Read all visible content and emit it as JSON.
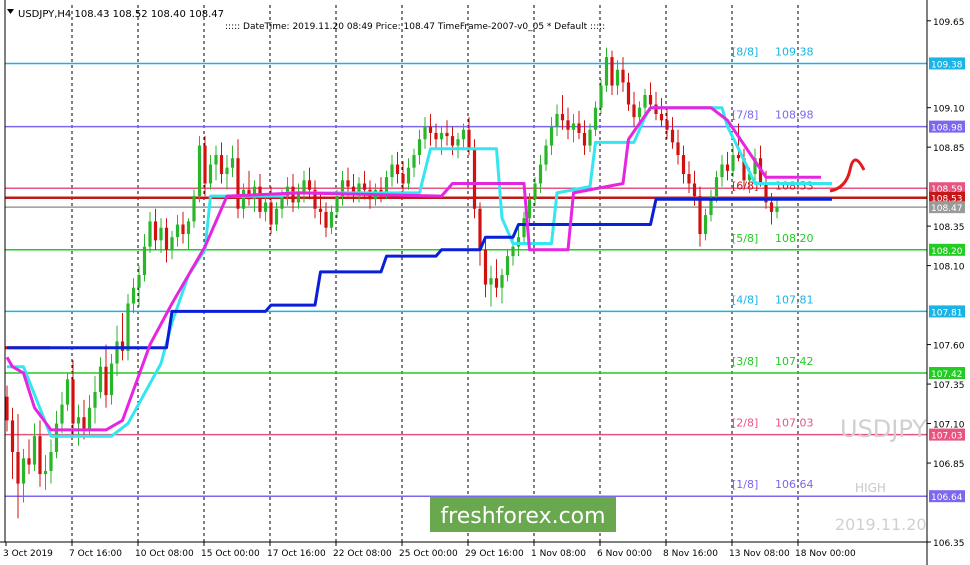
{
  "header": {
    "symbol_line": "USDJPY,H4  108.43 108.52 108.40 108.47",
    "info_line": "::::: DateTime: 2019.11.20 08:49   Price: 108.47   TimeFrame-2007-v0_05   *   Default   :::::"
  },
  "watermark": {
    "symbol": "USDJPY",
    "high_label": "HIGH",
    "datetime": "2019.11.20"
  },
  "brand": {
    "text": "freshforex.com",
    "color": "#6aa84f"
  },
  "colors": {
    "bull": "#2ab52a",
    "bear": "#d11010",
    "cyan_line": "#33e6f0",
    "blue_line": "#0a1fd8",
    "magenta_line": "#e526e0",
    "grid": "#000000"
  },
  "chart_data": {
    "type": "candlestick",
    "ylim": [
      106.35,
      109.75
    ],
    "y_ticks": [
      {
        "value": 109.65,
        "label": "109.65"
      },
      {
        "value": 109.38,
        "label": "109.38"
      },
      {
        "value": 109.1,
        "label": "109.10"
      },
      {
        "value": 108.98,
        "label": "108.98"
      },
      {
        "value": 108.85,
        "label": "108.85"
      },
      {
        "value": 108.59,
        "label": "108.59"
      },
      {
        "value": 108.53,
        "label": "108.53"
      },
      {
        "value": 108.47,
        "label": "108.47"
      },
      {
        "value": 108.35,
        "label": "108.35"
      },
      {
        "value": 108.2,
        "label": "108.20"
      },
      {
        "value": 108.1,
        "label": "108.10"
      },
      {
        "value": 107.81,
        "label": "107.81"
      },
      {
        "value": 107.6,
        "label": "107.60"
      },
      {
        "value": 107.42,
        "label": "107.42"
      },
      {
        "value": 107.35,
        "label": "107.35"
      },
      {
        "value": 107.1,
        "label": "107.10"
      },
      {
        "value": 107.03,
        "label": "107.03"
      },
      {
        "value": 106.85,
        "label": "106.85"
      },
      {
        "value": 106.64,
        "label": "106.64"
      },
      {
        "value": 106.35,
        "label": "106.35"
      }
    ],
    "x_labels": [
      {
        "label": "3 Oct 2019",
        "bar": 0
      },
      {
        "label": "7 Oct 16:00",
        "bar": 12
      },
      {
        "label": "10 Oct 08:00",
        "bar": 24
      },
      {
        "label": "15 Oct 00:00",
        "bar": 36
      },
      {
        "label": "17 Oct 16:00",
        "bar": 48
      },
      {
        "label": "22 Oct 08:00",
        "bar": 60
      },
      {
        "label": "25 Oct 00:00",
        "bar": 72
      },
      {
        "label": "29 Oct 16:00",
        "bar": 84
      },
      {
        "label": "1 Nov 08:00",
        "bar": 96
      },
      {
        "label": "6 Nov 00:00",
        "bar": 108
      },
      {
        "label": "8 Nov 16:00",
        "bar": 120
      },
      {
        "label": "13 Nov 08:00",
        "bar": 132
      },
      {
        "label": "18 Nov 00:00",
        "bar": 144
      }
    ],
    "levels": [
      {
        "name": "[8/8]",
        "value": 109.38,
        "label": "109.38",
        "color": "#19b3e6"
      },
      {
        "name": "[7/8]",
        "value": 108.98,
        "label": "108.98",
        "color": "#7b68ee"
      },
      {
        "name": "",
        "value": 108.59,
        "label": "108.59",
        "color": "#e75480"
      },
      {
        "name": "[6/8]",
        "value": 108.53,
        "label": "108.53",
        "color": "#c41818"
      },
      {
        "name": "",
        "value": 108.47,
        "label": "108.47",
        "color": "#9a9a9a"
      },
      {
        "name": "[5/8]",
        "value": 108.2,
        "label": "108.20",
        "color": "#22cc22"
      },
      {
        "name": "[4/8]",
        "value": 107.81,
        "label": "107.81",
        "color": "#19b3e6"
      },
      {
        "name": "[3/8]",
        "value": 107.42,
        "label": "107.42",
        "color": "#22cc22"
      },
      {
        "name": "[2/8]",
        "value": 107.03,
        "label": "107.03",
        "color": "#e75480"
      },
      {
        "name": "[1/8]",
        "value": 106.64,
        "label": "106.64",
        "color": "#7b68ee"
      }
    ],
    "candles": [
      [
        107.27,
        107.34,
        107.05,
        107.12
      ],
      [
        107.12,
        107.2,
        106.75,
        106.92
      ],
      [
        106.92,
        107.16,
        106.5,
        106.72
      ],
      [
        106.72,
        106.94,
        106.6,
        106.88
      ],
      [
        106.88,
        107.0,
        106.78,
        106.84
      ],
      [
        106.84,
        107.1,
        106.8,
        107.02
      ],
      [
        107.02,
        107.12,
        106.7,
        106.78
      ],
      [
        106.78,
        106.9,
        106.68,
        106.8
      ],
      [
        106.8,
        107.0,
        106.72,
        106.92
      ],
      [
        106.92,
        107.18,
        106.88,
        107.1
      ],
      [
        107.1,
        107.3,
        107.04,
        107.22
      ],
      [
        107.22,
        107.42,
        107.18,
        107.38
      ],
      [
        107.38,
        107.5,
        107.02,
        107.1
      ],
      [
        107.1,
        107.22,
        106.96,
        107.14
      ],
      [
        107.14,
        107.25,
        107.0,
        107.06
      ],
      [
        107.06,
        107.28,
        107.02,
        107.2
      ],
      [
        107.2,
        107.4,
        107.1,
        107.3
      ],
      [
        107.3,
        107.52,
        107.26,
        107.46
      ],
      [
        107.46,
        107.6,
        107.2,
        107.28
      ],
      [
        107.28,
        107.54,
        107.22,
        107.48
      ],
      [
        107.48,
        107.72,
        107.4,
        107.62
      ],
      [
        107.62,
        107.8,
        107.5,
        107.56
      ],
      [
        107.56,
        107.92,
        107.5,
        107.86
      ],
      [
        107.86,
        108.02,
        107.8,
        107.96
      ],
      [
        107.96,
        108.1,
        107.84,
        108.04
      ],
      [
        108.04,
        108.3,
        108.0,
        108.22
      ],
      [
        108.22,
        108.44,
        108.18,
        108.38
      ],
      [
        108.38,
        108.46,
        108.2,
        108.26
      ],
      [
        108.26,
        108.4,
        108.18,
        108.34
      ],
      [
        108.34,
        108.4,
        108.12,
        108.2
      ],
      [
        108.2,
        108.32,
        108.14,
        108.28
      ],
      [
        108.28,
        108.42,
        108.22,
        108.36
      ],
      [
        108.36,
        108.44,
        108.24,
        108.3
      ],
      [
        108.3,
        108.4,
        108.2,
        108.38
      ],
      [
        108.38,
        108.58,
        108.34,
        108.54
      ],
      [
        108.54,
        108.92,
        108.5,
        108.86
      ],
      [
        108.86,
        108.92,
        108.54,
        108.62
      ],
      [
        108.62,
        108.8,
        108.58,
        108.74
      ],
      [
        108.74,
        108.86,
        108.64,
        108.8
      ],
      [
        108.8,
        108.88,
        108.62,
        108.68
      ],
      [
        108.68,
        108.8,
        108.58,
        108.72
      ],
      [
        108.72,
        108.86,
        108.66,
        108.78
      ],
      [
        108.78,
        108.9,
        108.4,
        108.46
      ],
      [
        108.46,
        108.62,
        108.4,
        108.58
      ],
      [
        108.58,
        108.7,
        108.48,
        108.52
      ],
      [
        108.52,
        108.64,
        108.44,
        108.6
      ],
      [
        108.6,
        108.68,
        108.4,
        108.44
      ],
      [
        108.44,
        108.56,
        108.38,
        108.5
      ],
      [
        108.5,
        108.6,
        108.3,
        108.36
      ],
      [
        108.36,
        108.5,
        108.32,
        108.46
      ],
      [
        108.46,
        108.58,
        108.4,
        108.54
      ],
      [
        108.54,
        108.66,
        108.48,
        108.6
      ],
      [
        108.6,
        108.68,
        108.44,
        108.5
      ],
      [
        108.5,
        108.62,
        108.46,
        108.56
      ],
      [
        108.56,
        108.7,
        108.5,
        108.64
      ],
      [
        108.64,
        108.72,
        108.52,
        108.58
      ],
      [
        108.58,
        108.64,
        108.4,
        108.46
      ],
      [
        108.46,
        108.56,
        108.36,
        108.44
      ],
      [
        108.44,
        108.5,
        108.28,
        108.34
      ],
      [
        108.34,
        108.48,
        108.3,
        108.44
      ],
      [
        108.44,
        108.58,
        108.4,
        108.54
      ],
      [
        108.54,
        108.7,
        108.48,
        108.64
      ],
      [
        108.64,
        108.72,
        108.54,
        108.6
      ],
      [
        108.6,
        108.68,
        108.5,
        108.56
      ],
      [
        108.56,
        108.66,
        108.5,
        108.62
      ],
      [
        108.62,
        108.7,
        108.52,
        108.58
      ],
      [
        108.58,
        108.64,
        108.46,
        108.52
      ],
      [
        108.52,
        108.62,
        108.48,
        108.58
      ],
      [
        108.58,
        108.66,
        108.5,
        108.54
      ],
      [
        108.54,
        108.7,
        108.52,
        108.66
      ],
      [
        108.66,
        108.8,
        108.6,
        108.74
      ],
      [
        108.74,
        108.82,
        108.62,
        108.68
      ],
      [
        108.68,
        108.76,
        108.54,
        108.62
      ],
      [
        108.62,
        108.78,
        108.58,
        108.72
      ],
      [
        108.72,
        108.84,
        108.66,
        108.8
      ],
      [
        108.8,
        108.96,
        108.74,
        108.9
      ],
      [
        108.9,
        109.04,
        108.84,
        108.98
      ],
      [
        108.98,
        109.06,
        108.86,
        108.94
      ],
      [
        108.94,
        109.0,
        108.84,
        108.9
      ],
      [
        108.9,
        108.98,
        108.8,
        108.94
      ],
      [
        108.94,
        109.02,
        108.86,
        108.92
      ],
      [
        108.92,
        108.98,
        108.8,
        108.86
      ],
      [
        108.86,
        108.94,
        108.78,
        108.9
      ],
      [
        108.9,
        109.0,
        108.84,
        108.96
      ],
      [
        108.96,
        109.04,
        108.8,
        108.84
      ],
      [
        108.84,
        108.9,
        108.4,
        108.46
      ],
      [
        108.46,
        108.5,
        108.1,
        108.2
      ],
      [
        108.2,
        108.28,
        107.9,
        107.98
      ],
      [
        107.98,
        108.1,
        107.84,
        108.02
      ],
      [
        108.02,
        108.14,
        107.9,
        107.96
      ],
      [
        107.96,
        108.08,
        107.86,
        108.04
      ],
      [
        108.04,
        108.2,
        108.0,
        108.16
      ],
      [
        108.16,
        108.3,
        108.1,
        108.22
      ],
      [
        108.22,
        108.34,
        108.16,
        108.28
      ],
      [
        108.28,
        108.44,
        108.24,
        108.4
      ],
      [
        108.4,
        108.56,
        108.36,
        108.52
      ],
      [
        108.52,
        108.66,
        108.48,
        108.62
      ],
      [
        108.62,
        108.8,
        108.56,
        108.74
      ],
      [
        108.74,
        108.9,
        108.7,
        108.86
      ],
      [
        108.86,
        109.04,
        108.8,
        108.98
      ],
      [
        108.98,
        109.12,
        108.92,
        109.06
      ],
      [
        109.06,
        109.18,
        108.96,
        109.02
      ],
      [
        109.02,
        109.1,
        108.9,
        108.96
      ],
      [
        108.96,
        109.06,
        108.88,
        109.0
      ],
      [
        109.0,
        109.08,
        108.9,
        108.94
      ],
      [
        108.94,
        109.02,
        108.8,
        108.86
      ],
      [
        108.86,
        109.0,
        108.82,
        108.96
      ],
      [
        108.96,
        109.14,
        108.92,
        109.1
      ],
      [
        109.1,
        109.28,
        109.06,
        109.24
      ],
      [
        109.24,
        109.48,
        109.2,
        109.42
      ],
      [
        109.42,
        109.46,
        109.18,
        109.24
      ],
      [
        109.24,
        109.4,
        109.18,
        109.34
      ],
      [
        109.34,
        109.42,
        109.2,
        109.26
      ],
      [
        109.26,
        109.32,
        109.08,
        109.12
      ],
      [
        109.12,
        109.2,
        108.98,
        109.04
      ],
      [
        109.04,
        109.14,
        108.94,
        109.1
      ],
      [
        109.1,
        109.22,
        109.04,
        109.18
      ],
      [
        109.18,
        109.26,
        109.08,
        109.12
      ],
      [
        109.12,
        109.2,
        109.02,
        109.06
      ],
      [
        109.06,
        109.16,
        108.98,
        109.02
      ],
      [
        109.02,
        109.1,
        108.9,
        108.96
      ],
      [
        108.96,
        109.04,
        108.84,
        108.88
      ],
      [
        108.88,
        108.96,
        108.74,
        108.8
      ],
      [
        108.8,
        108.86,
        108.62,
        108.68
      ],
      [
        108.68,
        108.76,
        108.56,
        108.62
      ],
      [
        108.62,
        108.7,
        108.48,
        108.54
      ],
      [
        108.54,
        108.6,
        108.22,
        108.3
      ],
      [
        108.3,
        108.46,
        108.26,
        108.42
      ],
      [
        108.42,
        108.58,
        108.38,
        108.54
      ],
      [
        108.54,
        108.7,
        108.5,
        108.66
      ],
      [
        108.66,
        108.8,
        108.6,
        108.74
      ],
      [
        108.74,
        108.82,
        108.64,
        108.7
      ],
      [
        108.7,
        108.86,
        108.66,
        108.8
      ],
      [
        108.8,
        109.0,
        108.76,
        108.78
      ],
      [
        108.78,
        108.84,
        108.6,
        108.64
      ],
      [
        108.64,
        108.72,
        108.56,
        108.68
      ],
      [
        108.68,
        108.84,
        108.64,
        108.78
      ],
      [
        108.78,
        108.86,
        108.6,
        108.62
      ],
      [
        108.62,
        108.7,
        108.46,
        108.5
      ],
      [
        108.5,
        108.56,
        108.36,
        108.44
      ],
      [
        108.44,
        108.52,
        108.4,
        108.47
      ]
    ],
    "series": [
      {
        "values": [
          [
            0,
            107.46
          ],
          [
            3,
            107.46
          ],
          [
            8,
            107.02
          ],
          [
            19,
            107.02
          ],
          [
            22,
            107.1
          ],
          [
            28,
            107.48
          ],
          [
            30,
            107.74
          ],
          [
            33,
            108.04
          ],
          [
            36,
            108.2
          ],
          [
            37,
            108.54
          ],
          [
            50,
            108.54
          ],
          [
            51,
            108.56
          ],
          [
            58,
            108.56
          ],
          [
            75,
            108.56
          ],
          [
            77,
            108.84
          ],
          [
            89,
            108.84
          ],
          [
            90,
            108.4
          ],
          [
            92,
            108.24
          ],
          [
            99,
            108.24
          ],
          [
            100,
            108.56
          ],
          [
            106,
            108.6
          ],
          [
            107,
            108.88
          ],
          [
            114,
            108.88
          ],
          [
            116,
            109.04
          ],
          [
            117,
            109.1
          ],
          [
            130,
            109.1
          ],
          [
            131,
            108.98
          ],
          [
            133,
            108.84
          ],
          [
            136,
            108.62
          ],
          [
            150,
            108.62
          ]
        ]
      },
      {
        "values": [
          [
            0,
            107.58
          ],
          [
            29,
            107.58
          ],
          [
            30,
            107.81
          ],
          [
            47,
            107.81
          ],
          [
            48,
            107.85
          ],
          [
            56,
            107.85
          ],
          [
            57,
            108.06
          ],
          [
            68,
            108.06
          ],
          [
            69,
            108.16
          ],
          [
            78,
            108.16
          ],
          [
            79,
            108.2
          ],
          [
            86,
            108.2
          ],
          [
            87,
            108.28
          ],
          [
            92,
            108.28
          ],
          [
            93,
            108.36
          ],
          [
            117,
            108.36
          ],
          [
            118,
            108.52
          ],
          [
            150,
            108.52
          ]
        ]
      },
      {
        "values": [
          [
            0,
            107.52
          ],
          [
            1,
            107.46
          ],
          [
            3,
            107.42
          ],
          [
            5,
            107.2
          ],
          [
            8,
            107.06
          ],
          [
            18,
            107.06
          ],
          [
            21,
            107.12
          ],
          [
            26,
            107.6
          ],
          [
            30,
            107.86
          ],
          [
            36,
            108.22
          ],
          [
            40,
            108.54
          ],
          [
            53,
            108.56
          ],
          [
            79,
            108.54
          ],
          [
            81,
            108.62
          ],
          [
            94,
            108.62
          ],
          [
            95,
            108.2
          ],
          [
            97,
            108.2
          ],
          [
            102,
            108.2
          ],
          [
            103,
            108.56
          ],
          [
            112,
            108.62
          ],
          [
            113,
            108.9
          ],
          [
            117,
            109.1
          ],
          [
            128,
            109.1
          ],
          [
            131,
            109.02
          ],
          [
            138,
            108.66
          ],
          [
            148,
            108.66
          ]
        ]
      }
    ]
  }
}
